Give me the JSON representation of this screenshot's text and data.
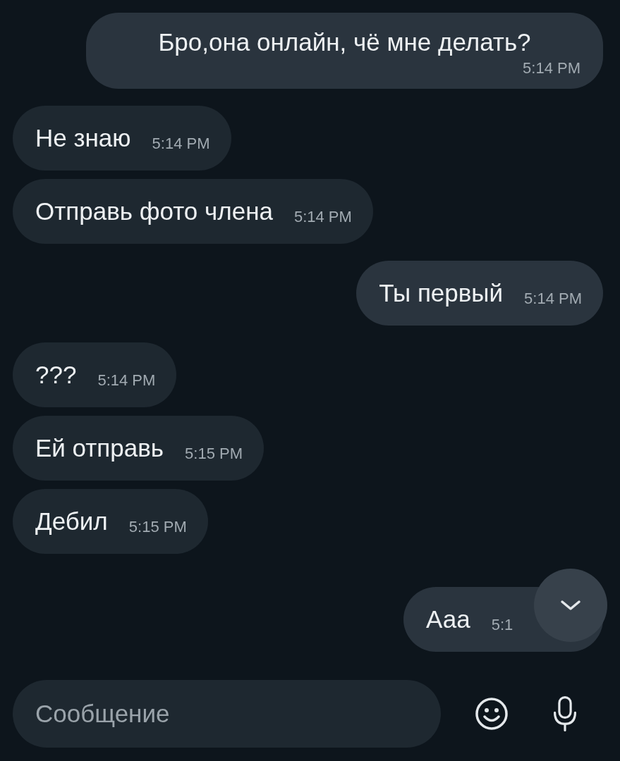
{
  "messages": [
    {
      "outgoing": true,
      "kind": "stacked",
      "text": "Бро,она онлайн, чё мне делать?",
      "time": "5:14 PM"
    },
    {
      "outgoing": false,
      "kind": "inline",
      "text": "Не знаю",
      "time": "5:14 PM"
    },
    {
      "outgoing": false,
      "kind": "inline",
      "text": "Отправь фото члена",
      "time": "5:14 PM"
    },
    {
      "outgoing": true,
      "kind": "inline",
      "text": "Ты первый",
      "time": "5:14 PM"
    },
    {
      "outgoing": false,
      "kind": "inline",
      "text": "???",
      "time": "5:14 PM"
    },
    {
      "outgoing": false,
      "kind": "inline",
      "text": "Ей отправь",
      "time": "5:15 PM"
    },
    {
      "outgoing": false,
      "kind": "inline",
      "text": "Дебил",
      "time": "5:15 PM"
    },
    {
      "outgoing": true,
      "kind": "inline",
      "text": "Ааа",
      "time": "5:1"
    }
  ],
  "scroll_down_button": {
    "shown": true
  },
  "composer": {
    "placeholder": "Сообщение"
  }
}
